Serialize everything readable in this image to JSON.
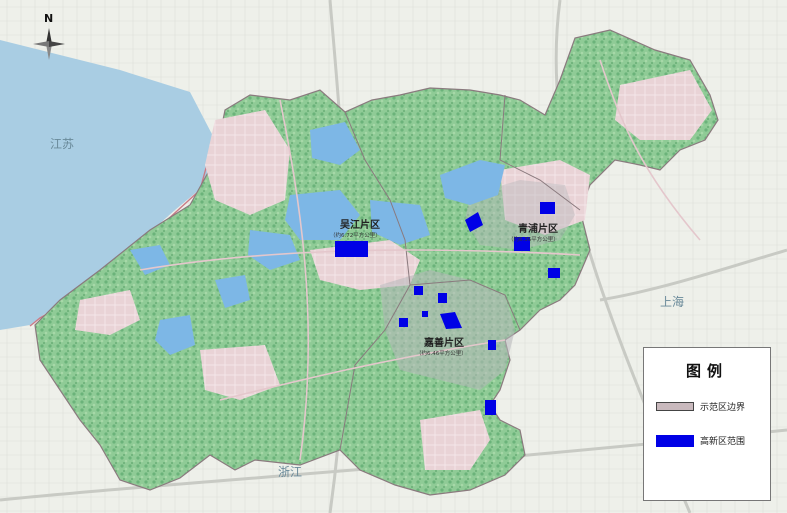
{
  "compass": {
    "north_label": "N"
  },
  "provinces": {
    "jiangsu": "江苏",
    "shanghai": "上海",
    "zhejiang": "浙江"
  },
  "districts": {
    "wujiang": {
      "name": "吴江片区",
      "area": "（约6.72平方公里）"
    },
    "qingpu": {
      "name": "青浦片区",
      "area": "（约6.36平方公里）"
    },
    "jiashan": {
      "name": "嘉善片区",
      "area": "（约6.46平方公里）"
    }
  },
  "legend": {
    "title": "图例",
    "items": [
      {
        "label": "示范区边界",
        "type": "boundary",
        "color": "#c9b9bd"
      },
      {
        "label": "高新区范围",
        "type": "zone",
        "color": "#0000e6"
      }
    ]
  },
  "colors": {
    "lake": "#a9cde3",
    "lake_border": "#c97a86",
    "urban": "#e8cfd3",
    "green": "#7fc08a",
    "water": "#7db7e6",
    "hightech": "#0000e6",
    "grey_zone": "#b8b8bc"
  }
}
